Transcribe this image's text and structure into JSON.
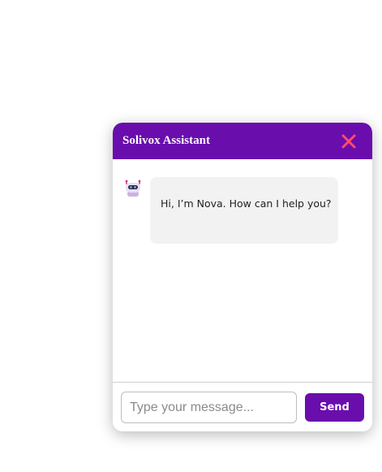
{
  "chat": {
    "title": "Solivox Assistant",
    "close_icon": "close-icon",
    "messages": [
      {
        "sender": "bot",
        "avatar_icon": "robot-icon",
        "text": "Hi, I’m Nova. How can I help you?"
      }
    ],
    "input": {
      "value": "",
      "placeholder": "Type your message..."
    },
    "send_label": "Send"
  },
  "colors": {
    "accent": "#6a0dad",
    "close": "#ff4d6d",
    "bubble": "#f2f2f2"
  }
}
